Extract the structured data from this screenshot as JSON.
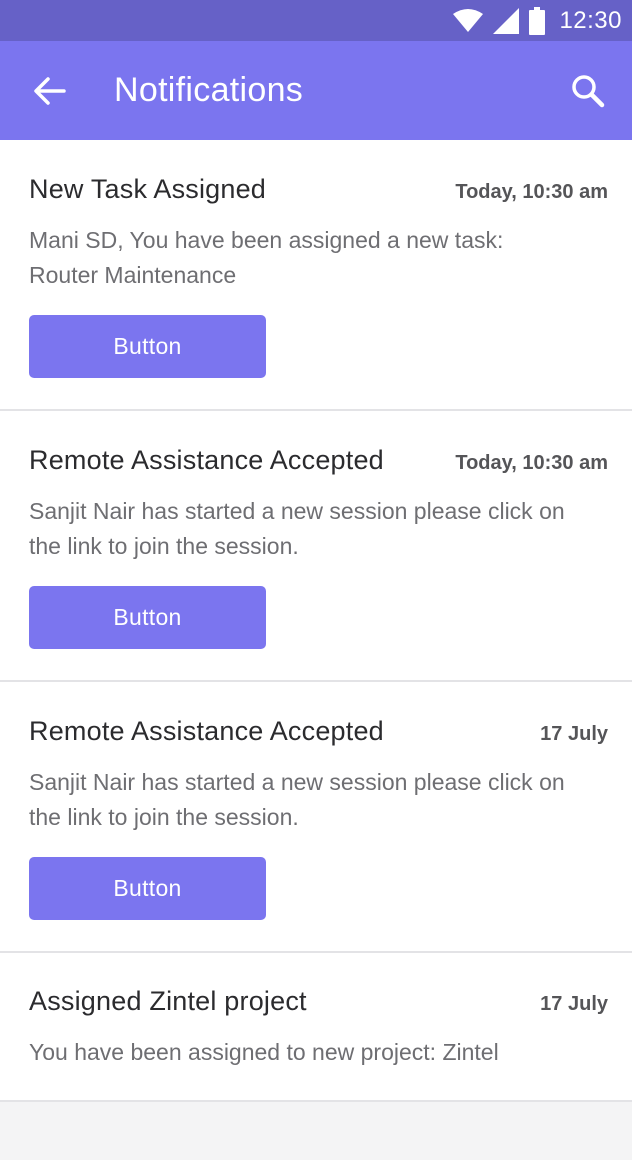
{
  "status_bar": {
    "time": "12:30",
    "icons": [
      "wifi-icon",
      "signal-icon",
      "battery-icon"
    ]
  },
  "app_bar": {
    "title": "Notifications",
    "back_icon": "arrow-left-icon",
    "search_icon": "search-icon"
  },
  "colors": {
    "status_bar": "#6661c7",
    "app_bar": "#7b75ef",
    "button": "#7b75ef",
    "background": "#f4f4f5"
  },
  "notifications": [
    {
      "title": "New Task Assigned",
      "time": "Today, 10:30 am",
      "body": "Mani SD, You have been assigned a new task: Router Maintenance",
      "button_label": "Button"
    },
    {
      "title": "Remote Assistance Accepted",
      "time": "Today, 10:30 am",
      "body": "Sanjit Nair has started a new session please click on the link to join the session.",
      "button_label": "Button"
    },
    {
      "title": "Remote Assistance Accepted",
      "time": "17 July",
      "body": "Sanjit Nair has started a new session please click on the link to join the session.",
      "button_label": "Button"
    },
    {
      "title": "Assigned Zintel project",
      "time": "17 July",
      "body": "You have been assigned to new project: Zintel"
    }
  ]
}
